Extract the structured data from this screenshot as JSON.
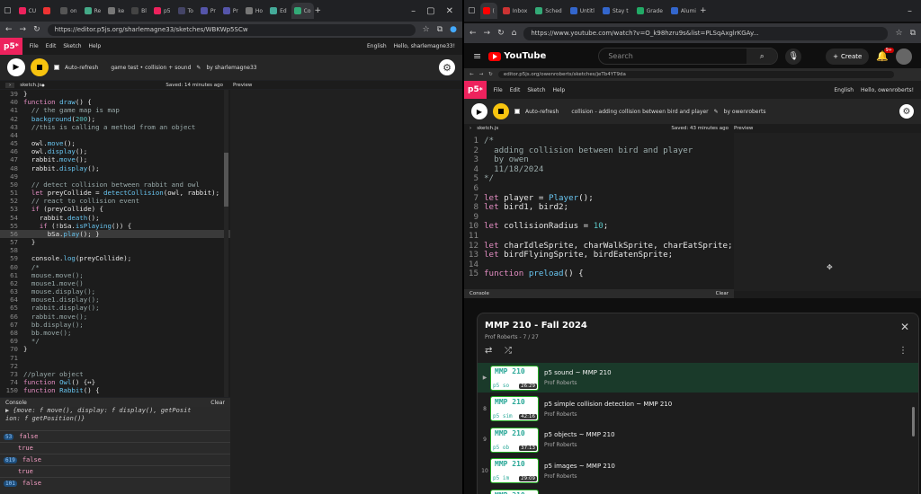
{
  "left": {
    "tabs": [
      "CU",
      "",
      "on",
      "Re",
      "ke",
      "Bl",
      "p5",
      "To",
      "Pr",
      "Pr",
      "Ho",
      "Ed",
      "Co"
    ],
    "url": "https://editor.p5js.org/sharlemagne33/sketches/WBKWp5SCw",
    "menu": [
      "File",
      "Edit",
      "Sketch",
      "Help"
    ],
    "lang": "English",
    "user": "Hello, sharlemagne33!",
    "auto_refresh": "Auto-refresh",
    "sketch_name": "game test • collision + sound",
    "by_user": "by sharlemagne33",
    "file": "sketch.js",
    "file_mark": "●",
    "saved": "Saved: 14 minutes ago",
    "preview": "Preview",
    "console_label": "Console",
    "clear": "Clear",
    "code_lines": [
      {
        "n": "39",
        "t": "}"
      },
      {
        "n": "40",
        "t": "function draw() {"
      },
      {
        "n": "41",
        "t": "  // the game map is map"
      },
      {
        "n": "42",
        "t": "  background(200);"
      },
      {
        "n": "43",
        "t": "  //this is calling a method from an object"
      },
      {
        "n": "44",
        "t": ""
      },
      {
        "n": "45",
        "t": "  owl.move();"
      },
      {
        "n": "46",
        "t": "  owl.display();"
      },
      {
        "n": "47",
        "t": "  rabbit.move();"
      },
      {
        "n": "48",
        "t": "  rabbit.display();"
      },
      {
        "n": "49",
        "t": ""
      },
      {
        "n": "50",
        "t": "  // detect collision between rabbit and owl"
      },
      {
        "n": "51",
        "t": "  let preyCollide = detectCollision(owl, rabbit);"
      },
      {
        "n": "52",
        "t": "  // react to collision event"
      },
      {
        "n": "53",
        "t": "  if (preyCollide) {"
      },
      {
        "n": "54",
        "t": "    rabbit.death();"
      },
      {
        "n": "55",
        "t": "    if (!bSa.isPlaying()) {"
      },
      {
        "n": "56",
        "t": "      bSa.play(); }"
      },
      {
        "n": "57",
        "t": "  }"
      },
      {
        "n": "58",
        "t": ""
      },
      {
        "n": "59",
        "t": "  console.log(preyCollide);"
      },
      {
        "n": "60",
        "t": "  /*"
      },
      {
        "n": "61",
        "t": "  mouse.move();"
      },
      {
        "n": "62",
        "t": "  mouse1.move()"
      },
      {
        "n": "63",
        "t": "  mouse.display();"
      },
      {
        "n": "64",
        "t": "  mouse1.display();"
      },
      {
        "n": "65",
        "t": "  rabbit.display();"
      },
      {
        "n": "66",
        "t": "  rabbit.move();"
      },
      {
        "n": "67",
        "t": "  bb.display();"
      },
      {
        "n": "68",
        "t": "  bb.move();"
      },
      {
        "n": "69",
        "t": "  */"
      },
      {
        "n": "70",
        "t": "}"
      },
      {
        "n": "71",
        "t": ""
      },
      {
        "n": "72",
        "t": ""
      },
      {
        "n": "73",
        "t": "//player object"
      },
      {
        "n": "74",
        "t": "function Owl() {↔}"
      },
      {
        "n": "150",
        "t": "function Rabbit() {"
      }
    ],
    "console_top": "▶ {move: f move(), display: f display(), getPosit",
    "console_top2": "ion: f getPosition()}",
    "console_rows": [
      {
        "count": "53",
        "value": "false"
      },
      {
        "count": "",
        "value": "true"
      },
      {
        "count": "619",
        "value": "false"
      },
      {
        "count": "",
        "value": "true"
      },
      {
        "count": "101",
        "value": "false"
      }
    ]
  },
  "right": {
    "tabs": [
      "(",
      "Inbox",
      "Sched",
      "Untitl",
      "Stay t",
      "Grade",
      "Alumi"
    ],
    "url": "https://www.youtube.com/watch?v=O_k98hzru9s&list=PLSqAxglrKGAy...",
    "yt_logo": "YouTube",
    "search_placeholder": "Search",
    "create": "Create",
    "notif_count": "9+",
    "inner_url": "editor.p5js.org/owenroberts/sketches/jeTb4YT9da",
    "menu": [
      "File",
      "Edit",
      "Sketch",
      "Help"
    ],
    "lang": "English",
    "user": "Hello, owenroberts!",
    "auto_refresh": "Auto-refresh",
    "sketch_name": "collision - adding collision between bird and player",
    "by_user": "by owenroberts",
    "file": "sketch.js",
    "saved": "Saved: 43 minutes ago",
    "preview": "Preview",
    "console_label": "Console",
    "clear": "Clear",
    "code_lines": [
      {
        "n": "1",
        "t": "/*"
      },
      {
        "n": "2",
        "t": "  adding collision between bird and player"
      },
      {
        "n": "3",
        "t": "  by owen"
      },
      {
        "n": "4",
        "t": "  11/18/2024"
      },
      {
        "n": "5",
        "t": "*/"
      },
      {
        "n": "6",
        "t": ""
      },
      {
        "n": "7",
        "t": "let player = Player();"
      },
      {
        "n": "8",
        "t": "let bird1, bird2;"
      },
      {
        "n": "9",
        "t": ""
      },
      {
        "n": "10",
        "t": "let collisionRadius = 10;"
      },
      {
        "n": "11",
        "t": ""
      },
      {
        "n": "12",
        "t": "let charIdleSprite, charWalkSprite, charEatSprite;"
      },
      {
        "n": "13",
        "t": "let birdFlyingSprite, birdEatenSprite;"
      },
      {
        "n": "14",
        "t": ""
      },
      {
        "n": "15",
        "t": "function preload() {"
      }
    ],
    "playlist_title": "MMP 210 - Fall 2024",
    "playlist_sub": "Prof Roberts - 7 / 27",
    "videos": [
      {
        "idx": "▶",
        "title": "p5 sound ~ MMP 210",
        "channel": "Prof Roberts",
        "dur": "26:29",
        "t1": "MMP 210",
        "t2": "p5 so"
      },
      {
        "idx": "8",
        "title": "p5 simple collision detection ~ MMP 210",
        "channel": "Prof Roberts",
        "dur": "42:16",
        "t1": "MMP 210",
        "t2": "p5 sim"
      },
      {
        "idx": "9",
        "title": "p5 objects ~ MMP 210",
        "channel": "Prof Roberts",
        "dur": "37:13",
        "t1": "MMP 210",
        "t2": "p5 ob"
      },
      {
        "idx": "10",
        "title": "p5 images ~ MMP 210",
        "channel": "Prof Roberts",
        "dur": "29:09",
        "t1": "MMP 210",
        "t2": "p5 im"
      },
      {
        "idx": "",
        "title": "Keyboard events ~ MMP 210",
        "channel": "",
        "dur": "",
        "t1": "MMP 210",
        "t2": ""
      }
    ]
  }
}
